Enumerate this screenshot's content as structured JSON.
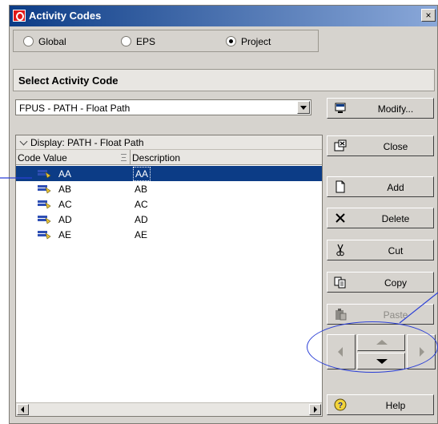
{
  "window": {
    "title": "Activity Codes",
    "close_glyph": "×"
  },
  "scope_radios": [
    {
      "label": "Global",
      "checked": false
    },
    {
      "label": "EPS",
      "checked": false
    },
    {
      "label": "Project",
      "checked": true
    }
  ],
  "section": {
    "title": "Select Activity Code"
  },
  "code_select": {
    "value": "FPUS - PATH - Float Path"
  },
  "grid": {
    "group_label": "Display: PATH - Float Path",
    "columns": [
      "Code Value",
      "Description"
    ],
    "rows": [
      {
        "code": "AA",
        "description": "AA",
        "selected": true
      },
      {
        "code": "AB",
        "description": "AB",
        "selected": false
      },
      {
        "code": "AC",
        "description": "AC",
        "selected": false
      },
      {
        "code": "AD",
        "description": "AD",
        "selected": false
      },
      {
        "code": "AE",
        "description": "AE",
        "selected": false
      }
    ]
  },
  "buttons": {
    "modify": "Modify...",
    "close": "Close",
    "add": "Add",
    "delete": "Delete",
    "cut": "Cut",
    "copy": "Copy",
    "paste": "Paste",
    "help": "Help"
  },
  "icons": {
    "app": "oracle-logo-icon",
    "modify": "modify-icon",
    "close": "close-window-icon",
    "add": "new-document-icon",
    "delete": "delete-x-icon",
    "cut": "scissors-icon",
    "copy": "copy-icon",
    "paste": "paste-icon",
    "help": "help-icon",
    "row": "activity-code-icon"
  },
  "colors": {
    "title_bar": "#0c3c86",
    "selection": "#0c3c86",
    "callout": "#2b3fd6",
    "dialog_bg": "#d6d3ce"
  }
}
